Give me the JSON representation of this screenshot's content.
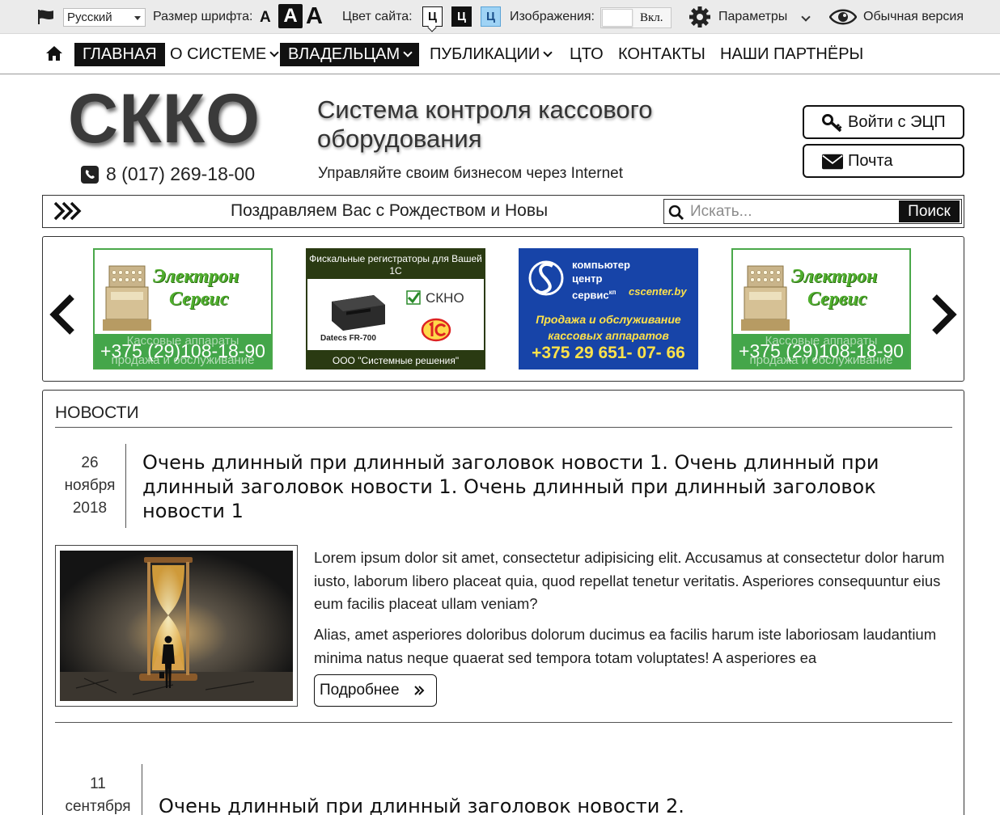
{
  "accessibility_bar": {
    "language": "Русский",
    "font_size_label": "Размер шрифта:",
    "font_sizes": [
      "A",
      "A",
      "A"
    ],
    "color_label": "Цвет сайта:",
    "color_buttons": [
      "Ц",
      "Ц",
      "Ц"
    ],
    "images_label": "Изображения:",
    "images_toggle": "Вкл.",
    "params_label": "Параметры",
    "normal_version": "Обычная версия"
  },
  "nav": {
    "home_icon": "home-icon",
    "items": [
      {
        "label": "ГЛАВНАЯ",
        "active": true
      },
      {
        "label": "О СИСТЕМЕ"
      },
      {
        "label": "ВЛАДЕЛЬЦАМ",
        "active": true
      },
      {
        "label": "ПУБЛИКАЦИИ"
      },
      {
        "label": "ЦТО"
      },
      {
        "label": "КОНТАКТЫ"
      },
      {
        "label": "НАШИ ПАРТНЁРЫ"
      }
    ]
  },
  "header": {
    "logo": "СККО",
    "phone": "8 (017) 269-18-00",
    "title": "Система контроля кассового оборудования",
    "subtitle": "Управляйте своим бизнесом через Internet",
    "login_button": "Войти с ЭЦП",
    "mail_button": "Почта"
  },
  "ticker": {
    "text": "Поздравляем Вас с Рождеством и Новы",
    "search_placeholder": "Искать...",
    "search_button": "Поиск"
  },
  "partners": {
    "electron_service": {
      "name_line1": "Электрон",
      "name_line2": "Сервис",
      "caption_top": "Кассовые аппараты",
      "phone": "+375 (29)108-18-90",
      "caption_bottom": "продажа и обслуживание"
    },
    "system_solutions": {
      "top": "Фискальные регистраторы для Вашей 1С",
      "model": "Datecs FR-700",
      "skno": "СКНО",
      "company": "ООО \"Системные решения\""
    },
    "cscenter": {
      "name": "компьютер центр сервис",
      "suffix": "кп",
      "site": "cscenter.by",
      "slogan": "Продажа и обслуживание кассовых аппаратов",
      "phone": "+375 29 651- 07- 66"
    }
  },
  "news": {
    "heading": "НОВОСТИ",
    "items": [
      {
        "day": "26",
        "month": "ноября",
        "year": "2018",
        "title": "Очень длинный при длинный заголовок новости 1. Очень длинный при длинный заголовок новости 1. Очень длинный при длинный заголовок новости 1",
        "paragraph1": "Lorem ipsum dolor sit amet, consectetur adipisicing elit. Accusamus at consectetur dolor harum iusto, laborum libero placeat quia, quod repellat tenetur veritatis. Asperiores consequuntur eius eum facilis placeat ullam veniam?",
        "paragraph2": "Alias, amet asperiores doloribus dolorum ducimus ea facilis harum iste laboriosam laudantium minima natus neque quaerat sed tempora totam voluptates! A asperiores ea",
        "more_button": "Подробнее"
      },
      {
        "day": "11",
        "month": "сентября",
        "title": "Очень длинный при длинный заголовок новости 2."
      }
    ]
  }
}
